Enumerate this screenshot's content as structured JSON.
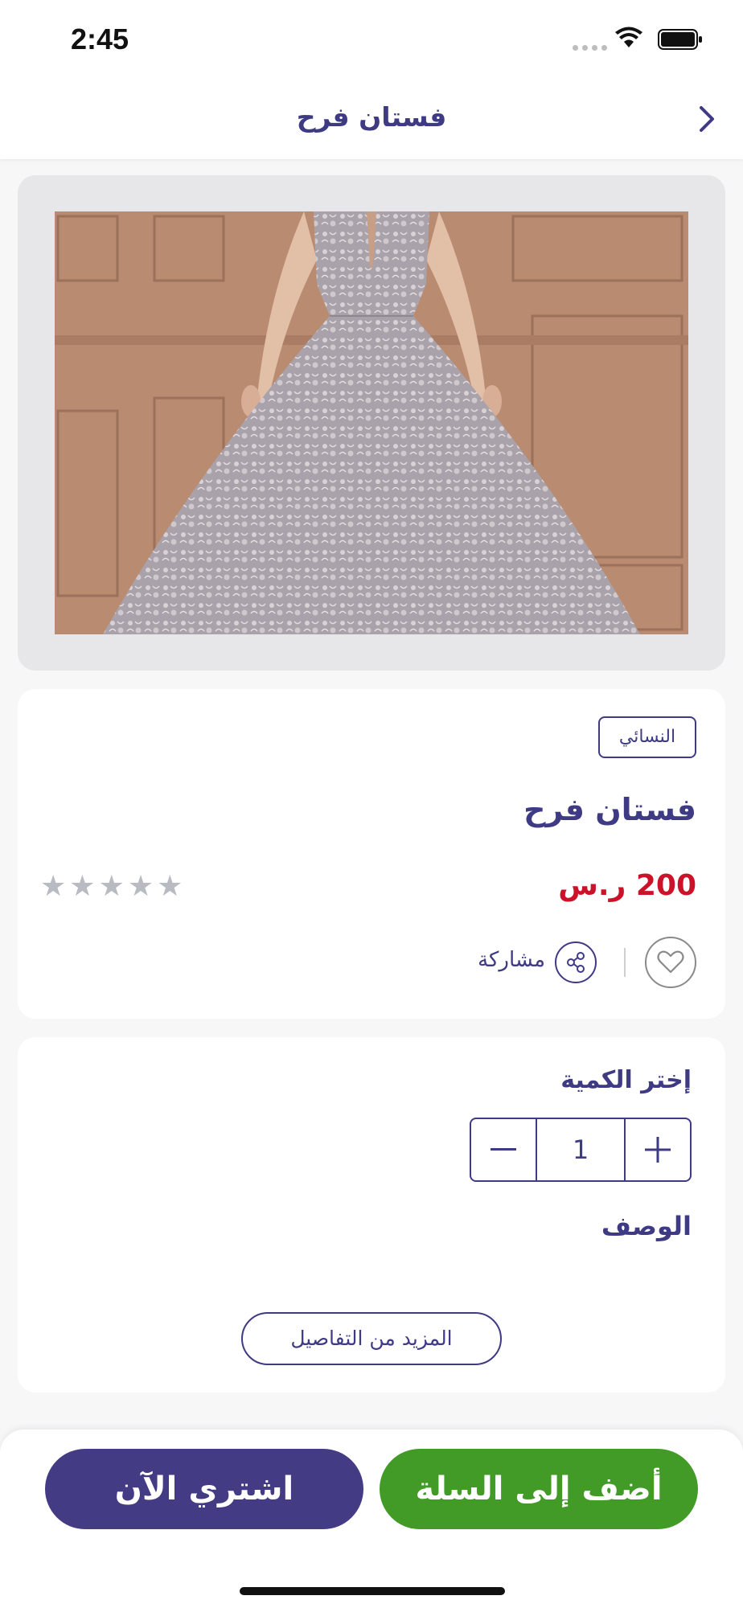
{
  "status_bar": {
    "time": "2:45"
  },
  "header": {
    "title": "فستان فرح"
  },
  "product": {
    "category": "النسائي",
    "title": "فستان فرح",
    "price": "200 ر.س",
    "rating_stars": 5,
    "rating_filled": 0,
    "share_label": "مشاركة"
  },
  "quantity": {
    "label": "إختر الكمية",
    "value": "1"
  },
  "description": {
    "label": "الوصف",
    "more_label": "المزيد من التفاصيل"
  },
  "actions": {
    "buy_now": "اشتري الآن",
    "add_to_cart": "أضف إلى السلة"
  },
  "colors": {
    "primary": "#3f3a84",
    "price": "#cc1228",
    "cart": "#429a27",
    "buy": "#433b83"
  }
}
